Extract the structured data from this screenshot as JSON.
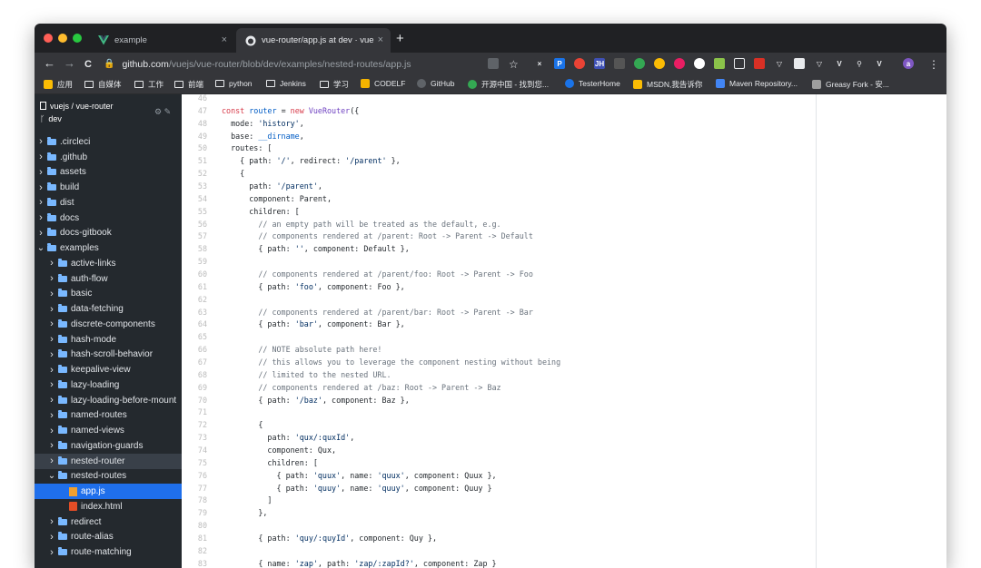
{
  "browser": {
    "tabs": [
      {
        "title": "example",
        "active": false
      },
      {
        "title": "vue-router/app.js at dev · vue",
        "active": true
      }
    ],
    "close_glyph": "×",
    "new_tab_glyph": "+",
    "back_glyph": "←",
    "forward_glyph": "→",
    "reload_glyph": "C",
    "url_host": "github.com",
    "url_path": "/vuejs/vue-router/blob/dev/examples/nested-routes/app.js",
    "star_glyph": "☆",
    "menu_glyph": "⋮"
  },
  "bookmarks": [
    {
      "label": "应用",
      "icon": "apps-grid-icon"
    },
    {
      "label": "自媒体",
      "icon": "folder-icon"
    },
    {
      "label": "工作",
      "icon": "folder-icon"
    },
    {
      "label": "前端",
      "icon": "folder-icon"
    },
    {
      "label": "python",
      "icon": "folder-icon"
    },
    {
      "label": "Jenkins",
      "icon": "folder-icon"
    },
    {
      "label": "学习",
      "icon": "folder-icon"
    },
    {
      "label": "CODELF",
      "icon": "codelf-icon"
    },
    {
      "label": "GitHub",
      "icon": "github-icon"
    },
    {
      "label": "开源中国 - 找到您...",
      "icon": "oschina-icon"
    },
    {
      "label": "TesterHome",
      "icon": "testerhome-icon"
    },
    {
      "label": "MSDN,我告诉你",
      "icon": "msdn-icon"
    },
    {
      "label": "Maven Repository...",
      "icon": "maven-icon"
    },
    {
      "label": "Greasy Fork - 安...",
      "icon": "greasyfork-icon"
    }
  ],
  "sidebar": {
    "repo": "vuejs / vue-router",
    "branch": "dev",
    "repo_icon": "repo-icon",
    "branch_icon": "branch-icon",
    "tools": "⚙ ✎",
    "tree": [
      {
        "label": ".circleci",
        "type": "folder",
        "depth": 0,
        "open": false
      },
      {
        "label": ".github",
        "type": "folder",
        "depth": 0,
        "open": false
      },
      {
        "label": "assets",
        "type": "folder",
        "depth": 0,
        "open": false
      },
      {
        "label": "build",
        "type": "folder",
        "depth": 0,
        "open": false
      },
      {
        "label": "dist",
        "type": "folder",
        "depth": 0,
        "open": false
      },
      {
        "label": "docs",
        "type": "folder",
        "depth": 0,
        "open": false
      },
      {
        "label": "docs-gitbook",
        "type": "folder",
        "depth": 0,
        "open": false
      },
      {
        "label": "examples",
        "type": "folder",
        "depth": 0,
        "open": true
      },
      {
        "label": "active-links",
        "type": "folder",
        "depth": 1,
        "open": false
      },
      {
        "label": "auth-flow",
        "type": "folder",
        "depth": 1,
        "open": false
      },
      {
        "label": "basic",
        "type": "folder",
        "depth": 1,
        "open": false
      },
      {
        "label": "data-fetching",
        "type": "folder",
        "depth": 1,
        "open": false
      },
      {
        "label": "discrete-components",
        "type": "folder",
        "depth": 1,
        "open": false
      },
      {
        "label": "hash-mode",
        "type": "folder",
        "depth": 1,
        "open": false
      },
      {
        "label": "hash-scroll-behavior",
        "type": "folder",
        "depth": 1,
        "open": false
      },
      {
        "label": "keepalive-view",
        "type": "folder",
        "depth": 1,
        "open": false
      },
      {
        "label": "lazy-loading",
        "type": "folder",
        "depth": 1,
        "open": false
      },
      {
        "label": "lazy-loading-before-mount",
        "type": "folder",
        "depth": 1,
        "open": false
      },
      {
        "label": "named-routes",
        "type": "folder",
        "depth": 1,
        "open": false
      },
      {
        "label": "named-views",
        "type": "folder",
        "depth": 1,
        "open": false
      },
      {
        "label": "navigation-guards",
        "type": "folder",
        "depth": 1,
        "open": false
      },
      {
        "label": "nested-router",
        "type": "folder",
        "depth": 1,
        "open": false,
        "hover": true
      },
      {
        "label": "nested-routes",
        "type": "folder",
        "depth": 1,
        "open": true
      },
      {
        "label": "app.js",
        "type": "js",
        "depth": 2,
        "selected": true
      },
      {
        "label": "index.html",
        "type": "html",
        "depth": 2
      },
      {
        "label": "redirect",
        "type": "folder",
        "depth": 1,
        "open": false
      },
      {
        "label": "route-alias",
        "type": "folder",
        "depth": 1,
        "open": false
      },
      {
        "label": "route-matching",
        "type": "folder",
        "depth": 1,
        "open": false
      }
    ]
  },
  "code": {
    "lines": [
      {
        "n": "46",
        "tokens": []
      },
      {
        "n": "47",
        "tokens": [
          [
            "kw",
            "const "
          ],
          [
            "var",
            "router"
          ],
          [
            "plain",
            " = "
          ],
          [
            "kw",
            "new "
          ],
          [
            "fn",
            "VueRouter"
          ],
          [
            "plain",
            "({"
          ]
        ]
      },
      {
        "n": "48",
        "tokens": [
          [
            "plain",
            "  mode: "
          ],
          [
            "str",
            "'history'"
          ],
          [
            "plain",
            ","
          ]
        ]
      },
      {
        "n": "49",
        "tokens": [
          [
            "plain",
            "  base: "
          ],
          [
            "var",
            "__dirname"
          ],
          [
            "plain",
            ","
          ]
        ]
      },
      {
        "n": "50",
        "tokens": [
          [
            "plain",
            "  routes: ["
          ]
        ]
      },
      {
        "n": "51",
        "tokens": [
          [
            "plain",
            "    { path: "
          ],
          [
            "str",
            "'/'"
          ],
          [
            "plain",
            ", redirect: "
          ],
          [
            "str",
            "'/parent'"
          ],
          [
            "plain",
            " },"
          ]
        ]
      },
      {
        "n": "52",
        "tokens": [
          [
            "plain",
            "    {"
          ]
        ]
      },
      {
        "n": "53",
        "tokens": [
          [
            "plain",
            "      path: "
          ],
          [
            "str",
            "'/parent'"
          ],
          [
            "plain",
            ","
          ]
        ]
      },
      {
        "n": "54",
        "tokens": [
          [
            "plain",
            "      component: Parent,"
          ]
        ]
      },
      {
        "n": "55",
        "tokens": [
          [
            "plain",
            "      children: ["
          ]
        ]
      },
      {
        "n": "56",
        "tokens": [
          [
            "cm",
            "        // an empty path will be treated as the default, e.g."
          ]
        ]
      },
      {
        "n": "57",
        "tokens": [
          [
            "cm",
            "        // components rendered at /parent: Root -> Parent -> Default"
          ]
        ]
      },
      {
        "n": "58",
        "tokens": [
          [
            "plain",
            "        { path: "
          ],
          [
            "str",
            "''"
          ],
          [
            "plain",
            ", component: Default },"
          ]
        ]
      },
      {
        "n": "59",
        "tokens": []
      },
      {
        "n": "60",
        "tokens": [
          [
            "cm",
            "        // components rendered at /parent/foo: Root -> Parent -> Foo"
          ]
        ]
      },
      {
        "n": "61",
        "tokens": [
          [
            "plain",
            "        { path: "
          ],
          [
            "str",
            "'foo'"
          ],
          [
            "plain",
            ", component: Foo },"
          ]
        ]
      },
      {
        "n": "62",
        "tokens": []
      },
      {
        "n": "63",
        "tokens": [
          [
            "cm",
            "        // components rendered at /parent/bar: Root -> Parent -> Bar"
          ]
        ]
      },
      {
        "n": "64",
        "tokens": [
          [
            "plain",
            "        { path: "
          ],
          [
            "str",
            "'bar'"
          ],
          [
            "plain",
            ", component: Bar },"
          ]
        ]
      },
      {
        "n": "65",
        "tokens": []
      },
      {
        "n": "66",
        "tokens": [
          [
            "cm",
            "        // NOTE absolute path here!"
          ]
        ]
      },
      {
        "n": "67",
        "tokens": [
          [
            "cm",
            "        // this allows you to leverage the component nesting without being"
          ]
        ]
      },
      {
        "n": "68",
        "tokens": [
          [
            "cm",
            "        // limited to the nested URL."
          ]
        ]
      },
      {
        "n": "69",
        "tokens": [
          [
            "cm",
            "        // components rendered at /baz: Root -> Parent -> Baz"
          ]
        ]
      },
      {
        "n": "70",
        "tokens": [
          [
            "plain",
            "        { path: "
          ],
          [
            "str",
            "'/baz'"
          ],
          [
            "plain",
            ", component: Baz },"
          ]
        ]
      },
      {
        "n": "71",
        "tokens": []
      },
      {
        "n": "72",
        "tokens": [
          [
            "plain",
            "        {"
          ]
        ]
      },
      {
        "n": "73",
        "tokens": [
          [
            "plain",
            "          path: "
          ],
          [
            "str",
            "'qux/:quxId'"
          ],
          [
            "plain",
            ","
          ]
        ]
      },
      {
        "n": "74",
        "tokens": [
          [
            "plain",
            "          component: Qux,"
          ]
        ]
      },
      {
        "n": "75",
        "tokens": [
          [
            "plain",
            "          children: ["
          ]
        ]
      },
      {
        "n": "76",
        "tokens": [
          [
            "plain",
            "            { path: "
          ],
          [
            "str",
            "'quux'"
          ],
          [
            "plain",
            ", name: "
          ],
          [
            "str",
            "'quux'"
          ],
          [
            "plain",
            ", component: Quux },"
          ]
        ]
      },
      {
        "n": "77",
        "tokens": [
          [
            "plain",
            "            { path: "
          ],
          [
            "str",
            "'quuy'"
          ],
          [
            "plain",
            ", name: "
          ],
          [
            "str",
            "'quuy'"
          ],
          [
            "plain",
            ", component: Quuy }"
          ]
        ]
      },
      {
        "n": "78",
        "tokens": [
          [
            "plain",
            "          ]"
          ]
        ]
      },
      {
        "n": "79",
        "tokens": [
          [
            "plain",
            "        },"
          ]
        ]
      },
      {
        "n": "80",
        "tokens": []
      },
      {
        "n": "81",
        "tokens": [
          [
            "plain",
            "        { path: "
          ],
          [
            "str",
            "'quy/:quyId'"
          ],
          [
            "plain",
            ", component: Quy },"
          ]
        ]
      },
      {
        "n": "82",
        "tokens": []
      },
      {
        "n": "83",
        "tokens": [
          [
            "plain",
            "        { name: "
          ],
          [
            "str",
            "'zap'"
          ],
          [
            "plain",
            ", path: "
          ],
          [
            "str",
            "'zap/:zapId?'"
          ],
          [
            "plain",
            ", component: Zap }"
          ]
        ]
      }
    ]
  },
  "colors": {
    "chrome_dark": "#202124",
    "toolbar": "#35363a",
    "sidebar": "#24292e",
    "selected": "#1f6feb",
    "string": "#032f62",
    "keyword": "#d73a49",
    "comment": "#6a737d"
  }
}
